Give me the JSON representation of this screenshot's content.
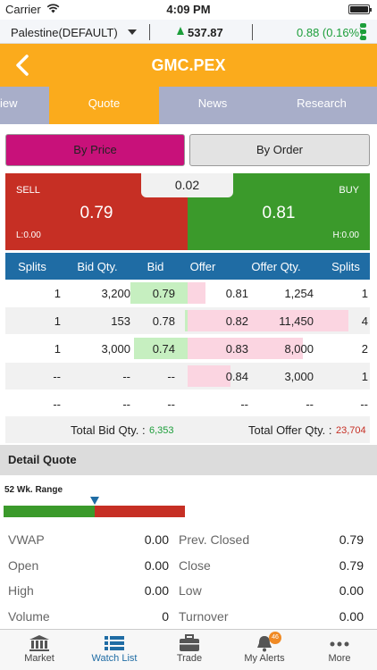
{
  "status": {
    "carrier": "Carrier",
    "time": "4:09 PM"
  },
  "market": {
    "name": "Palestine(DEFAULT)",
    "index": "537.87",
    "change": "0.88 (0.16%)",
    "up_color": "#1c9e3a"
  },
  "header": {
    "title": "GMC.PEX",
    "brand_color": "#fbab1c"
  },
  "tabs": [
    {
      "label": "iew",
      "active": false
    },
    {
      "label": "Quote",
      "active": true
    },
    {
      "label": "News",
      "active": false
    },
    {
      "label": "Research",
      "active": false
    }
  ],
  "toggle": {
    "by_price": "By Price",
    "by_order": "By Order"
  },
  "price": {
    "spread": "0.02",
    "sell_label": "SELL",
    "sell": "0.79",
    "low": "L:0.00",
    "buy_label": "BUY",
    "buy": "0.81",
    "high": "H:0.00"
  },
  "depth": {
    "columns": [
      "Splits",
      "Bid Qty.",
      "Bid",
      "Offer",
      "Offer Qty.",
      "Splits"
    ],
    "rows": [
      {
        "bid_splits": "1",
        "bid_qty": "3,200",
        "bid": "0.79",
        "offer": "0.81",
        "offer_qty": "1,254",
        "offer_splits": "1",
        "bid_fill": 0.98,
        "offer_fill": 0.11
      },
      {
        "bid_splits": "1",
        "bid_qty": "153",
        "bid": "0.78",
        "offer": "0.82",
        "offer_qty": "11,450",
        "offer_splits": "4",
        "bid_fill": 0.05,
        "offer_fill": 0.98
      },
      {
        "bid_splits": "1",
        "bid_qty": "3,000",
        "bid": "0.74",
        "offer": "0.83",
        "offer_qty": "8,000",
        "offer_splits": "2",
        "bid_fill": 0.92,
        "offer_fill": 0.7
      },
      {
        "bid_splits": "--",
        "bid_qty": "--",
        "bid": "--",
        "offer": "0.84",
        "offer_qty": "3,000",
        "offer_splits": "1",
        "bid_fill": 0,
        "offer_fill": 0.26
      },
      {
        "bid_splits": "--",
        "bid_qty": "--",
        "bid": "--",
        "offer": "--",
        "offer_qty": "--",
        "offer_splits": "--",
        "bid_fill": 0,
        "offer_fill": 0
      }
    ],
    "total_bid_label": "Total Bid Qty. :",
    "total_bid": "6,353",
    "total_offer_label": "Total Offer Qty. :",
    "total_offer": "23,704"
  },
  "detail": {
    "title": "Detail Quote",
    "range_label": "52 Wk. Range",
    "range_position": 0.5,
    "items": [
      {
        "left_label": "VWAP",
        "left_value": "0.00",
        "right_label": "Prev. Closed",
        "right_value": "0.79"
      },
      {
        "left_label": "Open",
        "left_value": "0.00",
        "right_label": "Close",
        "right_value": "0.79"
      },
      {
        "left_label": "High",
        "left_value": "0.00",
        "right_label": "Low",
        "right_value": "0.00"
      },
      {
        "left_label": "Volume",
        "left_value": "0",
        "right_label": "Turnover",
        "right_value": "0.00"
      }
    ]
  },
  "tabbar": {
    "items": [
      {
        "label": "Market",
        "icon": "bank-icon"
      },
      {
        "label": "Watch List",
        "icon": "list-icon",
        "active": true
      },
      {
        "label": "Trade",
        "icon": "briefcase-icon"
      },
      {
        "label": "My Alerts",
        "icon": "bell-icon",
        "badge": "46"
      },
      {
        "label": "More",
        "icon": "more-dots-icon"
      }
    ]
  }
}
